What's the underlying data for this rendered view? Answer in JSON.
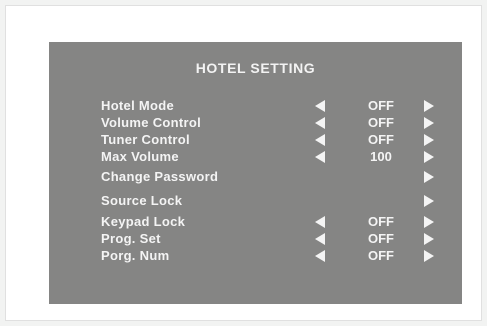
{
  "menu": {
    "title": "HOTEL SETTING",
    "items": [
      {
        "label": "Hotel Mode",
        "value": "OFF",
        "left_arrow": true,
        "right_arrow": true
      },
      {
        "label": "Volume Control",
        "value": "OFF",
        "left_arrow": true,
        "right_arrow": true
      },
      {
        "label": "Tuner Control",
        "value": "OFF",
        "left_arrow": true,
        "right_arrow": true
      },
      {
        "label": "Max Volume",
        "value": "100",
        "left_arrow": true,
        "right_arrow": true
      },
      {
        "label": "Change Password",
        "value": "",
        "left_arrow": false,
        "right_arrow": true
      },
      {
        "label": "Source Lock",
        "value": "",
        "left_arrow": false,
        "right_arrow": true
      },
      {
        "label": "Keypad Lock",
        "value": "OFF",
        "left_arrow": true,
        "right_arrow": true
      },
      {
        "label": "Prog. Set",
        "value": "OFF",
        "left_arrow": true,
        "right_arrow": true
      },
      {
        "label": "Porg. Num",
        "value": "OFF",
        "left_arrow": true,
        "right_arrow": true
      }
    ]
  },
  "icons": {
    "left": "left-triangle-icon",
    "right": "right-triangle-icon"
  },
  "colors": {
    "panel": "#858584",
    "text": "#f4f4f4",
    "background": "#f2f3f2"
  }
}
